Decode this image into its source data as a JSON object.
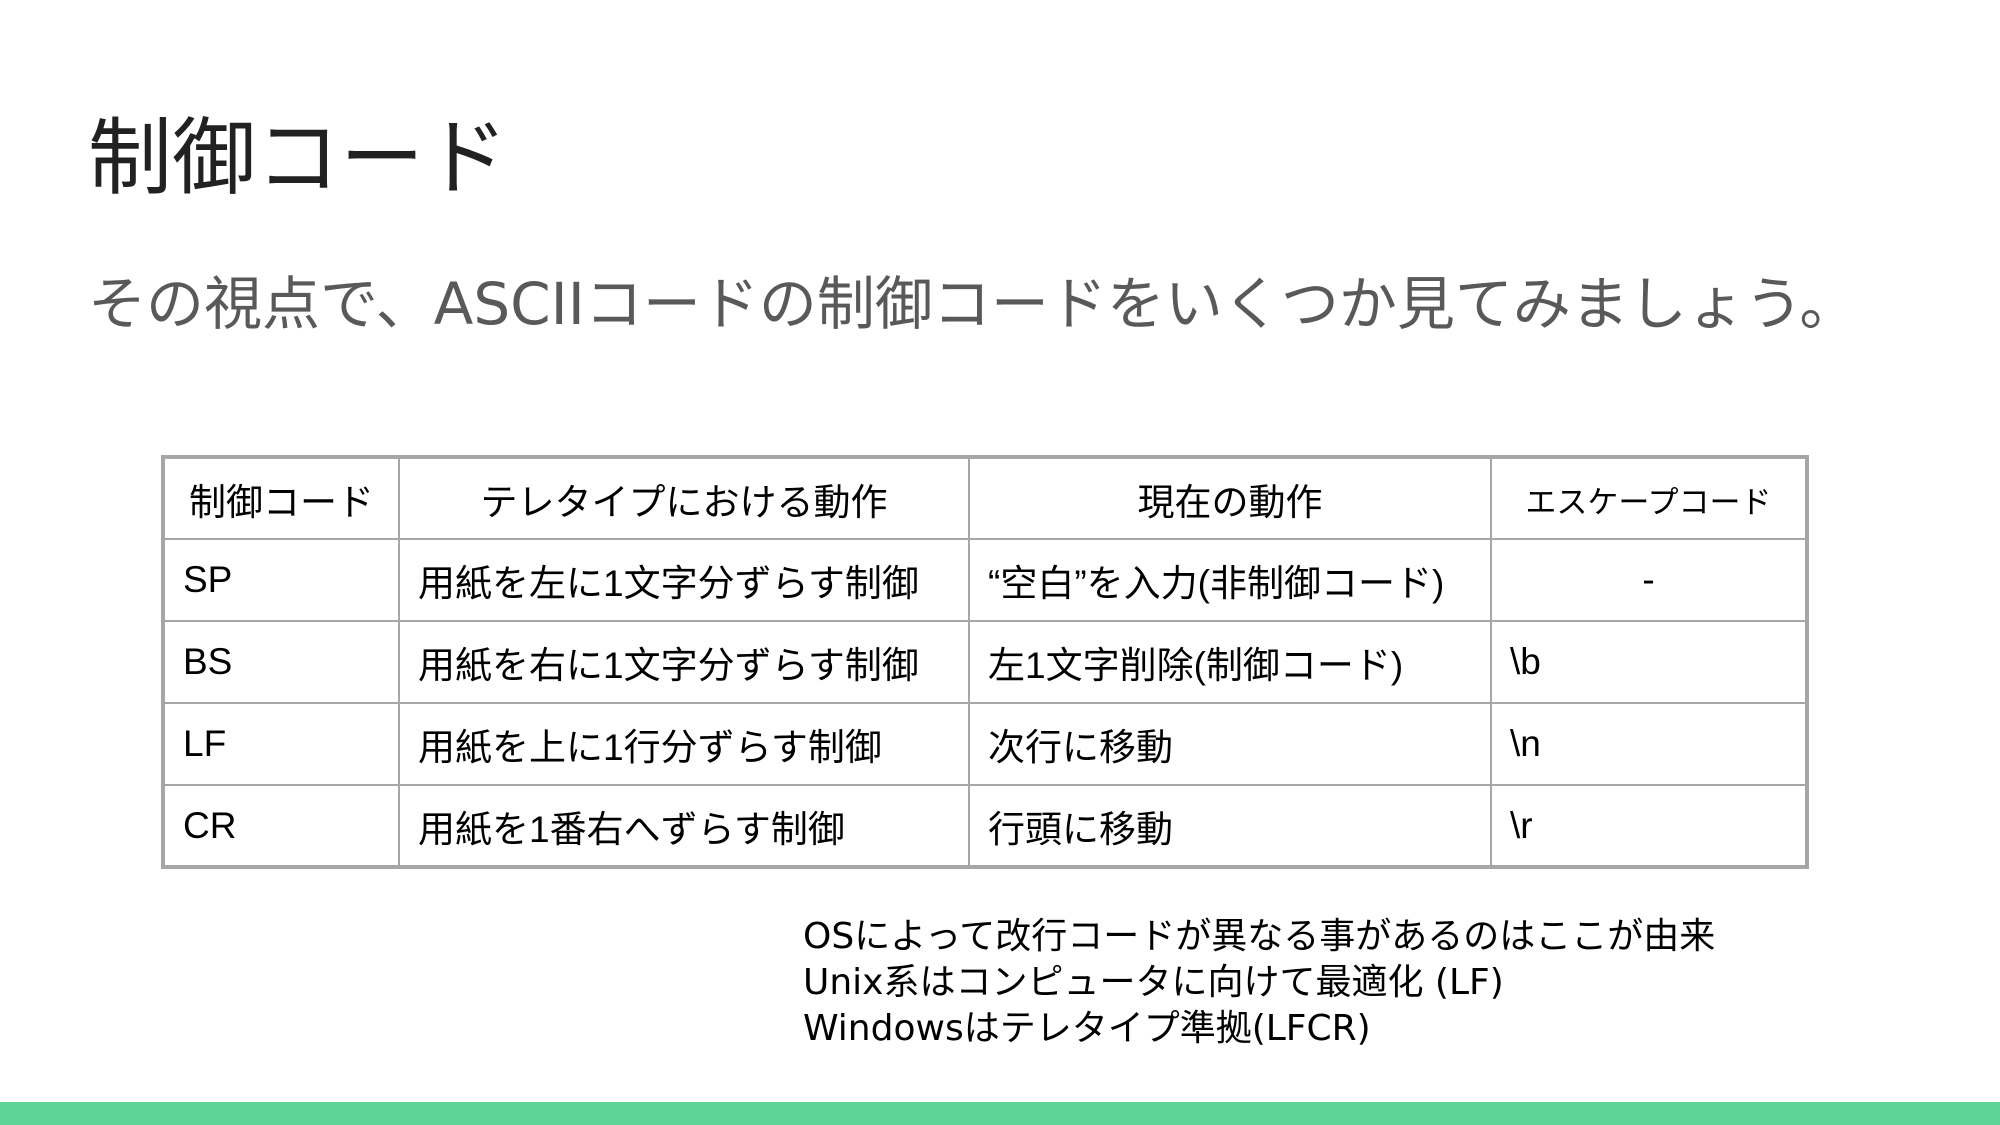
{
  "slide": {
    "title": "制御コード",
    "subtitle": "その視点で、ASCIIコードの制御コードをいくつか見てみましょう。"
  },
  "table": {
    "headers": [
      "制御コード",
      "テレタイプにおける動作",
      "現在の動作",
      "エスケープコード"
    ],
    "rows": [
      [
        "SP",
        "用紙を左に1文字分ずらす制御",
        "“空白”を入力(非制御コード)",
        "-"
      ],
      [
        "BS",
        "用紙を右に1文字分ずらす制御",
        "左1文字削除(制御コード)",
        "\\b"
      ],
      [
        "LF",
        "用紙を上に1行分ずらす制御",
        "次行に移動",
        "\\n"
      ],
      [
        "CR",
        "用紙を1番右へずらす制御",
        "行頭に移動",
        "\\r"
      ]
    ]
  },
  "note": {
    "lines": [
      "OSによって改行コードが異なる事があるのはここが由来",
      "Unix系はコンピュータに向けて最適化 (LF)",
      "Windowsはテレタイプ準拠(LFCR)"
    ]
  },
  "colors": {
    "footer_bar": "#5fd497",
    "table_border": "#a6a6a6",
    "title_text": "#212121",
    "subtitle_text": "#595959"
  }
}
